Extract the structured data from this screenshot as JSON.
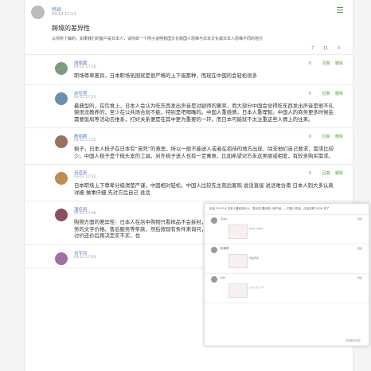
{
  "post": {
    "username": "韩颖",
    "time": "03-12 17:13",
    "title": "跨境的差异性",
    "body": "以你所了解的，如果我们的客户是日本人，请你举一个例子说明我国文化和国人思维与日本文化或日本人思维不同的地方",
    "stats": [
      "7",
      "11",
      "0"
    ]
  },
  "replies": [
    {
      "username": "胡佩雯",
      "time": "03-12 17:20",
      "likes": "0",
      "action_reply": "回复",
      "action_delete": "删除",
      "text": "职场尊卑差异，日本职场氛围就是很严格的上下级那种，而现在中国的会轻松很多",
      "avatar_color": "#7a9e7e"
    },
    {
      "username": "余佳莹",
      "time": "03-12 17:21",
      "likes": "0",
      "action_reply": "回复",
      "action_delete": "删除",
      "text": "最典型的，在饮食上，日本人会认为吃东西发出声音是对厨师的褒奖，而大部分中国会觉得吃东西发出声音是很不礼貌很没教养的，至少在公共场合就不能，特别是吧唧嘴的。中国人重感情，日本人重理智。中国人的商务更多时候会需要饭局等活动去维系，打好关系便是在其中更为重要的一环。而日本可能就不太注重这些人情上的往来。",
      "avatar_color": "#6a8fb0"
    },
    {
      "username": "杨丽群",
      "time": "03-12 17:22",
      "likes": "0",
      "action_reply": "回复",
      "action_delete": "删除",
      "text": "梳子。日本人梳子在日本有“苦死”的意思，所以一般不能送人或者在招待的地方出现，除非他们自己要求，需求比较少。中国人梳子是个梳头发的工具，另外梳子送人也有一定寓意，比如希望对方永远美丽或相爱，有较多购买需求。",
      "avatar_color": "#9a7060"
    },
    {
      "username": "何道来",
      "time": "03-12 17:22",
      "likes": "0",
      "action_reply": "回复",
      "action_delete": "删除",
      "text": "日本职场上下尊卑分级清楚严谨，中国相对轻松。中国人比较先主观后客观 说话直接 说话难含南 日本人则大多认真 详细 做事仔细 先对方后自己 说话",
      "avatar_color": "#c08a50"
    },
    {
      "username": "潘佳雨",
      "time": "03-12 17:09",
      "likes": "0",
      "action_reply": "回复",
      "action_delete": "删除",
      "text": "购物方面的差异性：日本人在店中购物只看样品不会拆封，中国人购物追求性价比，不仅比较价格，也很注重售后服务的文字价格。售后服务等条款，然后按现有条件来询问，日本人较为讲规则，一旦发生售后问题，就会进行一系列讨价还价后再决定买不买，也",
      "avatar_color": "#8a5060"
    },
    {
      "username": "何宇玲",
      "time": "03-12 17:44",
      "likes": "0",
      "action_reply": "回复",
      "action_delete": "删除",
      "text": "",
      "avatar_color": "#a070a0"
    }
  ],
  "overlay": {
    "header": "长话 10:47 8 日本人喜欢送什么，表示送 喜欢送一种产品……中国人的话，应该说明 2020 年了",
    "items": [
      {
        "name": "Suzu",
        "caption": "Hello, Kitty!",
        "action": "回复"
      },
      {
        "name": "秋嘉晴",
        "caption": "商品详情",
        "action": "回复"
      },
      {
        "name": "kiki",
        "caption": "ショッピング",
        "action": "回复"
      }
    ],
    "footer": "查看更多回复"
  },
  "colors": {
    "link": "#5a85ba",
    "accent": "#5c9f3d"
  }
}
